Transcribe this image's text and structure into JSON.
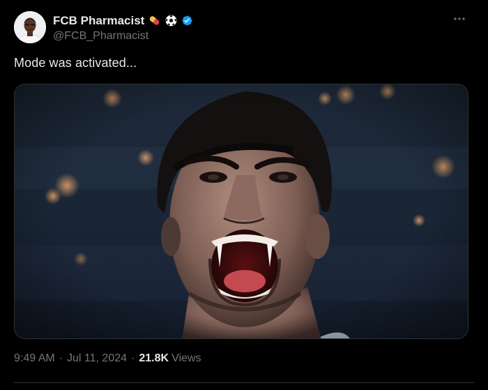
{
  "author": {
    "display_name": "FCB Pharmacist",
    "handle": "@FCB_Pharmacist",
    "name_emojis": [
      "pill-emoji",
      "soccer-ball-emoji"
    ],
    "verified": true,
    "verified_color": "#1d9bf0"
  },
  "tweet": {
    "text": "Mode was activated..."
  },
  "meta": {
    "time": "9:49 AM",
    "separator": "·",
    "date": "Jul 11, 2024",
    "views_count": "21.8K",
    "views_label": "Views"
  },
  "colors": {
    "background": "#000000",
    "primary_text": "#e7e9ea",
    "secondary_text": "#71767b",
    "border": "#2f3336"
  },
  "icons": {
    "more": "more-horizontal-icon",
    "verified": "verified-badge-icon"
  }
}
